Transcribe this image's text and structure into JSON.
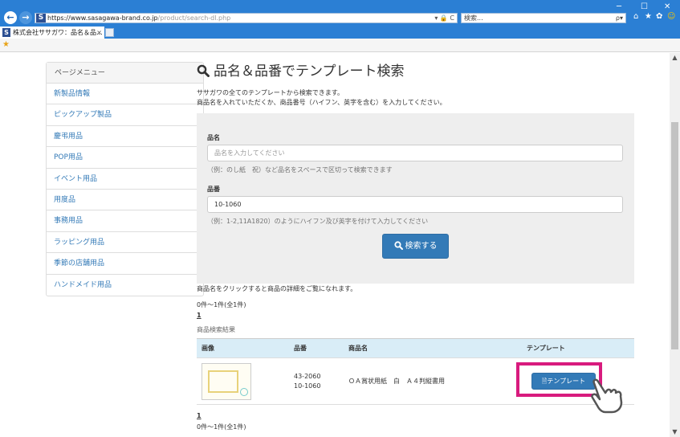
{
  "browser": {
    "url_prefix": "https://",
    "url_domain": "www.sasagawa-brand.co.jp",
    "url_path": "/product/search-dl.php",
    "url_tools": "▾ 🔒 C",
    "search_placeholder": "検索...",
    "search_icon": "ρ▾",
    "tab_title": "株式会社ササガワ：品名＆品...",
    "tab_close": "×",
    "favicon_letter": "S",
    "back_glyph": "←",
    "forward_glyph": "→",
    "win_min": "─",
    "win_max": "☐",
    "win_close": "✕",
    "home_icon": "⌂",
    "star_icon": "★",
    "gear_icon": "✿",
    "smiley_icon": "☺"
  },
  "sidebar": {
    "header": "ページメニュー",
    "items": [
      {
        "label": "新製品情報"
      },
      {
        "label": "ピックアップ製品"
      },
      {
        "label": "慶弔用品"
      },
      {
        "label": "POP用品"
      },
      {
        "label": "イベント用品"
      },
      {
        "label": "用度品"
      },
      {
        "label": "事務用品"
      },
      {
        "label": "ラッピング用品"
      },
      {
        "label": "季節の店舗用品"
      },
      {
        "label": "ハンドメイド用品"
      }
    ]
  },
  "main": {
    "title": "品名＆品番でテンプレート検索",
    "intro_line1": "ササガワの全てのテンプレートから検索できます。",
    "intro_line2": "商品名を入れていただくか、商品番号（ハイフン、英字を含む）を入力してください。",
    "form": {
      "name_label": "品名",
      "name_placeholder": "品名を入力してください",
      "name_help": "（例：のし紙　祝）など品名をスペースで区切って検索できます",
      "code_label": "品番",
      "code_value": "10-1060",
      "code_help": "（例：1-2,11A1820）のようにハイフン及び英字を付けて入力してください",
      "search_button": "検索する"
    },
    "click_hint": "商品名をクリックすると商品の詳細をご覧になれます。",
    "count_top": "0件〜1件(全1件)",
    "page_top": "1",
    "results_caption": "商品検索結果",
    "table": {
      "headers": [
        "画像",
        "品番",
        "商品名",
        "テンプレート"
      ],
      "rows": [
        {
          "code_line1": "43-2060",
          "code_line2": "10-1060",
          "name": "ＯＡ賞状用紙　白　Ａ４判縦書用",
          "template_button": "テンプレート"
        }
      ]
    },
    "page_bottom": "1",
    "count_bottom": "0件〜1件(全1件)"
  },
  "colors": {
    "brand_blue": "#337ab7",
    "table_header": "#d9edf7",
    "highlight": "#d81b7e",
    "chrome_blue": "#2b7fd4"
  }
}
